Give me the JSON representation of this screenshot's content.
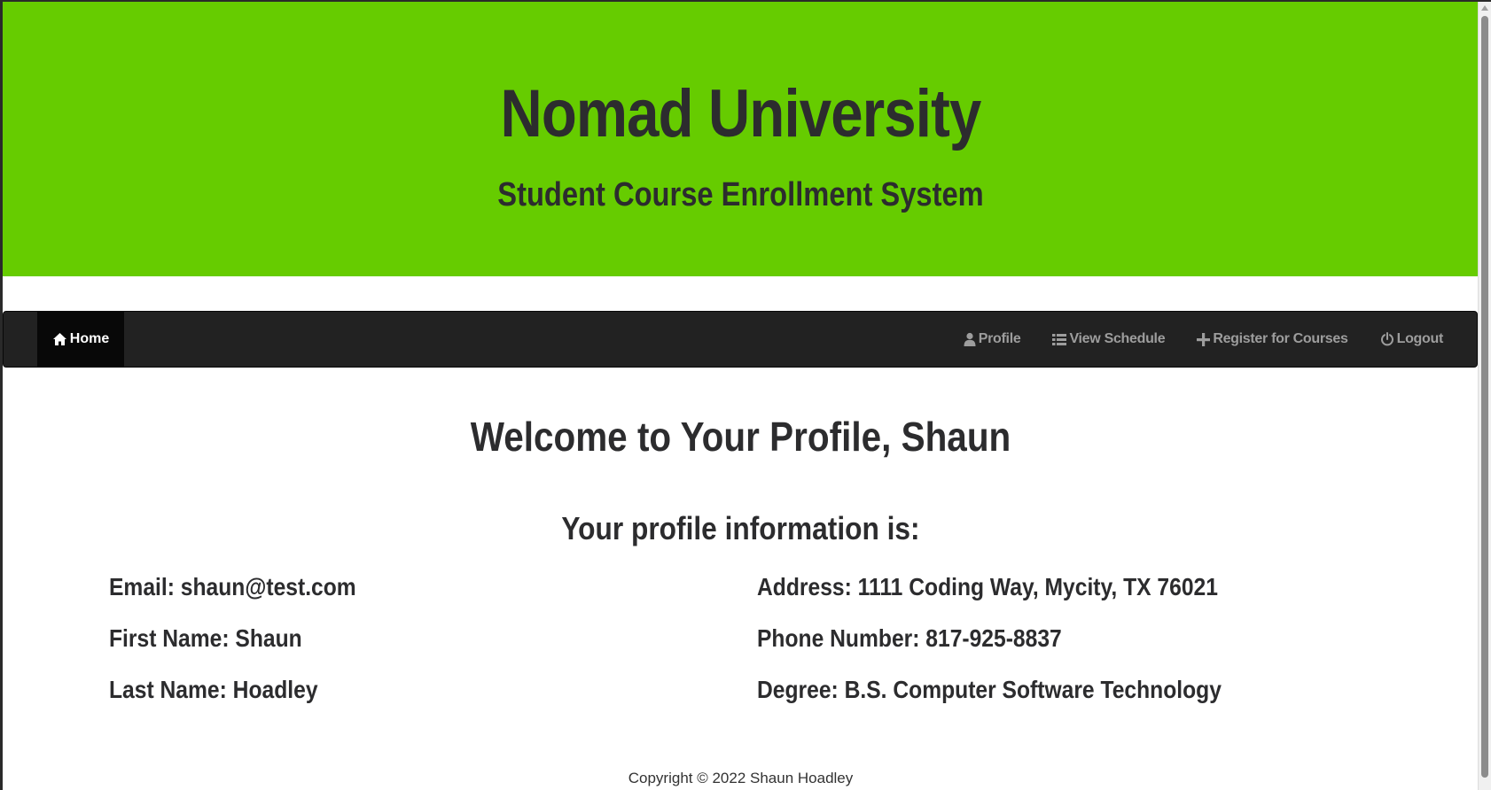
{
  "header": {
    "title": "Nomad University",
    "subtitle": "Student Course Enrollment System"
  },
  "navbar": {
    "home": {
      "label": "Home",
      "icon": "home-icon"
    },
    "items": [
      {
        "label": "Profile",
        "icon": "user-icon"
      },
      {
        "label": "View Schedule",
        "icon": "list-icon"
      },
      {
        "label": "Register for Courses",
        "icon": "plus-icon"
      },
      {
        "label": "Logout",
        "icon": "power-icon"
      }
    ]
  },
  "main": {
    "welcome": "Welcome to Your Profile, Shaun",
    "info_heading": "Your profile information is:",
    "left_fields": [
      "Email: shaun@test.com",
      "First Name: Shaun",
      "Last Name: Hoadley"
    ],
    "right_fields": [
      "Address: 1111 Coding Way, Mycity, TX 76021",
      "Phone Number: 817-925-8837",
      "Degree: B.S. Computer Software Technology"
    ]
  },
  "footer": {
    "copyright": "Copyright © 2022 Shaun Hoadley"
  },
  "colors": {
    "header_bg": "#66cc00",
    "navbar_bg": "#222222",
    "text_dark": "#2c2c2e",
    "nav_text": "#9d9d9d"
  }
}
